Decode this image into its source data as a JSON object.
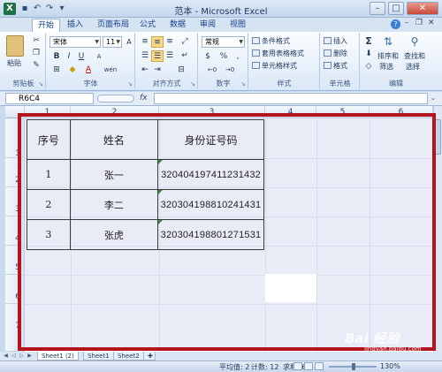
{
  "window": {
    "title": "范本 - Microsoft Excel",
    "app_icon": "excel-icon",
    "buttons": [
      "minimize-icon",
      "maximize-icon",
      "close-icon"
    ]
  },
  "tabs": [
    {
      "label": "开始",
      "active": true
    },
    {
      "label": "插入"
    },
    {
      "label": "页面布局"
    },
    {
      "label": "公式"
    },
    {
      "label": "数据"
    },
    {
      "label": "审阅"
    },
    {
      "label": "视图"
    }
  ],
  "ribbon": {
    "clipboard": {
      "paste": "粘贴",
      "label": "剪贴板"
    },
    "font": {
      "name": "宋体",
      "size": "11",
      "bold": "B",
      "italic": "I",
      "underline": "U",
      "grow": "A",
      "shrink": "A",
      "font_color": "A",
      "phonetic": "wén",
      "label": "字体"
    },
    "alignment": {
      "label": "对齐方式"
    },
    "number": {
      "format": "常规",
      "percent": "%",
      "label": "数字"
    },
    "styles": {
      "conditional": "条件格式",
      "table": "套用表格格式",
      "cell": "单元格样式",
      "label": "样式"
    },
    "cells": {
      "insert": "插入",
      "delete": "删除",
      "format": "格式",
      "label": "单元格"
    },
    "editing": {
      "sum": "Σ",
      "sort": "排序和",
      "sort2": "筛选",
      "find": "查找和",
      "find2": "选择",
      "label": "编辑"
    }
  },
  "formula_bar": {
    "name_box": "R6C4",
    "fx": "fx",
    "value": ""
  },
  "columns": [
    "1",
    "2",
    "3",
    "4",
    "5",
    "6"
  ],
  "rows": [
    "1",
    "2",
    "3",
    "4",
    "5",
    "6",
    "7"
  ],
  "table": {
    "headers": [
      "序号",
      "姓名",
      "身份证号码"
    ],
    "rows": [
      [
        "1",
        "张一",
        "320404197411231432"
      ],
      [
        "2",
        "李二",
        "320304198810241431"
      ],
      [
        "3",
        "张虎",
        "320304198801271531"
      ]
    ]
  },
  "sheet_tabs": [
    "Sheet1 (2)",
    "Sheet1",
    "Sheet2"
  ],
  "status": {
    "average": "平均值: 2",
    "count": "计数: 12",
    "sum": "求和: 6",
    "zoom": "130%"
  },
  "watermark": {
    "text": "Bai 经验",
    "url": "jingyan.baidu.com"
  },
  "colors": {
    "highlight_border": "#b5141c",
    "ribbon_bg": "#dbe8f7",
    "active_tab": "#ffffff"
  }
}
